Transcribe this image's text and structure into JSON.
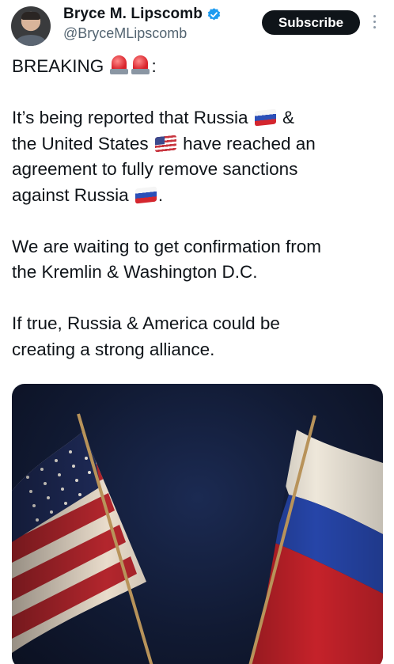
{
  "author": {
    "display_name": "Bryce M. Lipscomb",
    "handle": "@BryceMLipscomb",
    "verified": true
  },
  "actions": {
    "subscribe_label": "Subscribe"
  },
  "tweet": {
    "line1_prefix": "BREAKING",
    "line1_suffix": ":",
    "p2_a": "It’s being reported that Russia",
    "p2_b": "&",
    "p2_c": "the United States",
    "p2_d": "have reached an",
    "p2_e": "agreement to fully remove sanctions",
    "p2_f": "against Russia",
    "p2_g": ".",
    "p3_a": "We are waiting to get confirmation from",
    "p3_b": "the Kremlin & Washington D.C.",
    "p4_a": "If true, Russia & America could be",
    "p4_b": "creating a strong alliance."
  },
  "icons": {
    "verified": "verified-badge-icon",
    "more": "more-vertical-icon",
    "siren": "police-siren-emoji",
    "flag_russia": "russia-flag-emoji",
    "flag_usa": "usa-flag-emoji"
  },
  "colors": {
    "verified_blue": "#1d9bf0",
    "text_primary": "#0f1419",
    "text_secondary": "#536471",
    "button_bg": "#0f1419"
  }
}
